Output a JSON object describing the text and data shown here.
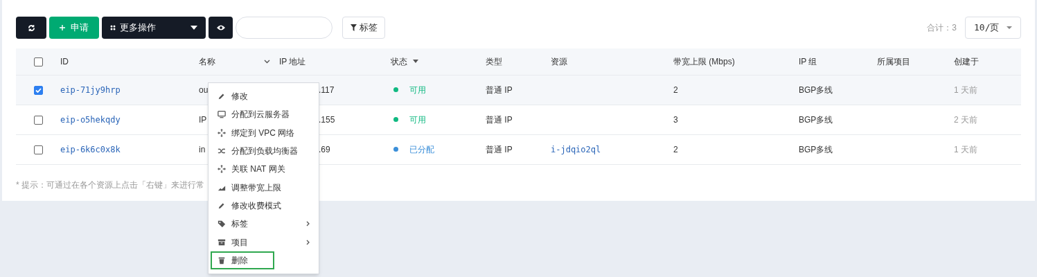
{
  "toolbar": {
    "apply_label": "申请",
    "more_label": "更多操作",
    "tag_label": "标签",
    "total": "合计：3",
    "page_size": "10/页"
  },
  "table": {
    "select_all_checked": false,
    "columns": [
      "ID",
      "名称",
      "IP 地址",
      "状态",
      "类型",
      "资源",
      "带宽上限 (Mbps)",
      "IP 组",
      "所属项目",
      "创建于"
    ],
    "rows": [
      {
        "checked": true,
        "id": "eip-71jy9hrp",
        "name": "ou",
        "ip": ".117",
        "status": "可用",
        "color": "#10b981",
        "type": "普通 IP",
        "resource": "",
        "bandwidth": "2",
        "ip_group": "BGP多线",
        "project": "",
        "created": "1 天前"
      },
      {
        "checked": false,
        "id": "eip-o5hekqdy",
        "name": "IP",
        "ip": ".155",
        "status": "可用",
        "color": "#10b981",
        "type": "普通 IP",
        "resource": "",
        "bandwidth": "3",
        "ip_group": "BGP多线",
        "project": "",
        "created": "2 天前"
      },
      {
        "checked": false,
        "id": "eip-6k6c0x8k",
        "name": "in",
        "ip": ".69",
        "status": "已分配",
        "color": "#3b8fd9",
        "type": "普通 IP",
        "resource": "i-jdqio2ql",
        "bandwidth": "2",
        "ip_group": "BGP多线",
        "project": "",
        "created": "1 天前"
      }
    ]
  },
  "hint": "* 提示：可通过在各个资源上点击「右键」来进行常",
  "context_menu": [
    {
      "kind": "pencil",
      "label": "修改",
      "submenu": false,
      "highlighted": false
    },
    {
      "kind": "monitor",
      "label": "分配到云服务器",
      "submenu": false,
      "highlighted": false
    },
    {
      "kind": "arrows",
      "label": "绑定到 VPC 网络",
      "submenu": false,
      "highlighted": false
    },
    {
      "kind": "shuffle",
      "label": "分配到负载均衡器",
      "submenu": false,
      "highlighted": false
    },
    {
      "kind": "arrows",
      "label": "关联 NAT 网关",
      "submenu": false,
      "highlighted": false
    },
    {
      "kind": "chart",
      "label": "调整带宽上限",
      "submenu": false,
      "highlighted": false
    },
    {
      "kind": "pencil",
      "label": "修改收费模式",
      "submenu": false,
      "highlighted": false
    },
    {
      "kind": "tag",
      "label": "标签",
      "submenu": true,
      "highlighted": false
    },
    {
      "kind": "archive",
      "label": "项目",
      "submenu": true,
      "highlighted": false
    },
    {
      "kind": "trash",
      "label": "删除",
      "submenu": false,
      "highlighted": true
    }
  ]
}
